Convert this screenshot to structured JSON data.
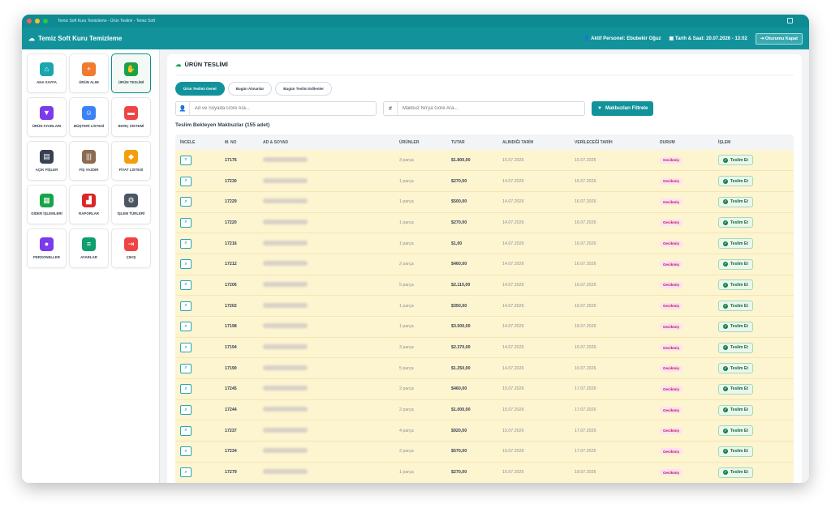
{
  "window": {
    "title": "Temiz Soft Kuru Temizleme - Ürün Teslimi - Temiz Soft"
  },
  "header": {
    "brand": "Temiz Soft Kuru Temizleme",
    "personel_label": "Aktif Personel:",
    "personel_name": "Ebubekir Oğuz",
    "datetime_label": "Tarih & Saat:",
    "datetime_value": "20.07.2026 - 13:02",
    "logout": "Oturumu Kapat"
  },
  "sidebar": {
    "items": [
      {
        "label": "ANA SAYFA",
        "icon": "home-icon",
        "color": "#1aa6ad",
        "glyph": "⌂"
      },
      {
        "label": "ÜRÜN ALIM",
        "icon": "plus-circle-icon",
        "color": "#f07b2e",
        "glyph": "+"
      },
      {
        "label": "ÜRÜN TESLİMİ",
        "icon": "hand-icon",
        "color": "#16a34a",
        "glyph": "✋",
        "active": true
      },
      {
        "label": "ÜRÜN AYARLARI",
        "icon": "tshirt-icon",
        "color": "#7c3aed",
        "glyph": "▼"
      },
      {
        "label": "MÜŞTERİ LİSTESİ",
        "icon": "users-icon",
        "color": "#3b82f6",
        "glyph": "☺"
      },
      {
        "label": "BORÇ SİSTEMİ",
        "icon": "wallet-icon",
        "color": "#ef4444",
        "glyph": "▬"
      },
      {
        "label": "AÇIK FİŞLER",
        "icon": "file-icon",
        "color": "#374151",
        "glyph": "▤"
      },
      {
        "label": "FİŞ YAZDIR",
        "icon": "barcode-icon",
        "color": "#8b6a4f",
        "glyph": "|||"
      },
      {
        "label": "FİYAT LİSTESİ",
        "icon": "tag-icon",
        "color": "#f59e0b",
        "glyph": "◆"
      },
      {
        "label": "GİDER İŞLEMLERİ",
        "icon": "receipt-icon",
        "color": "#16a34a",
        "glyph": "▦"
      },
      {
        "label": "RAPORLAR",
        "icon": "chart-icon",
        "color": "#dc2626",
        "glyph": "▟"
      },
      {
        "label": "İŞLEM TÜRLERİ",
        "icon": "gears-icon",
        "color": "#4b5563",
        "glyph": "⚙"
      },
      {
        "label": "PERSONELLER",
        "icon": "user-icon",
        "color": "#7c3aed",
        "glyph": "●"
      },
      {
        "label": "AYARLAR",
        "icon": "sliders-icon",
        "color": "#0e9f6e",
        "glyph": "≡"
      },
      {
        "label": "ÇIKIŞ",
        "icon": "logout-icon",
        "color": "#ef4444",
        "glyph": "⇥"
      }
    ]
  },
  "main": {
    "title": "ÜRÜN TESLİMİ",
    "tabs": [
      "Ürün Teslimi Genel",
      "Bugün Alınanlar",
      "Bugün Teslim Edilenler"
    ],
    "search_name_placeholder": "Ad ve Soyada Göre Ara...",
    "search_no_placeholder": "Makbuz No'ya Göre Ara...",
    "filter_button": "Makbuzları Filtrele",
    "section_title": "Teslim Bekleyen Makbuzlar (155 adet)",
    "columns": [
      "İNCELE",
      "M. NO",
      "AD & SOYAD",
      "ÜRÜNLER",
      "TUTAR",
      "ALINDIĞI TARİH",
      "VERİLECEĞİ TARİH",
      "DURUM",
      "İŞLEM"
    ],
    "status_label": "Gecikmiş",
    "action_label": "Teslim Et",
    "rows": [
      {
        "no": "17176",
        "items": "3 parça",
        "total": "$1.800,00",
        "received": "15.07.2026",
        "due": "15.07.2026"
      },
      {
        "no": "17230",
        "items": "1 parça",
        "total": "$270,00",
        "received": "14.07.2026",
        "due": "16.07.2026"
      },
      {
        "no": "17229",
        "items": "1 parça",
        "total": "$500,00",
        "received": "14.07.2026",
        "due": "16.07.2026"
      },
      {
        "no": "17220",
        "items": "1 parça",
        "total": "$270,00",
        "received": "14.07.2026",
        "due": "16.07.2026"
      },
      {
        "no": "17216",
        "items": "1 parça",
        "total": "$1,00",
        "received": "14.07.2026",
        "due": "16.07.2026"
      },
      {
        "no": "17212",
        "items": "2 parça",
        "total": "$460,00",
        "received": "14.07.2026",
        "due": "16.07.2026"
      },
      {
        "no": "17206",
        "items": "5 parça",
        "total": "$2.110,00",
        "received": "14.07.2026",
        "due": "16.07.2026"
      },
      {
        "no": "17202",
        "items": "1 parça",
        "total": "$350,00",
        "received": "14.07.2026",
        "due": "16.07.2026"
      },
      {
        "no": "17198",
        "items": "1 parça",
        "total": "$3.500,00",
        "received": "14.07.2026",
        "due": "18.07.2026"
      },
      {
        "no": "17194",
        "items": "3 parça",
        "total": "$2.370,00",
        "received": "14.07.2026",
        "due": "16.07.2026"
      },
      {
        "no": "17190",
        "items": "5 parça",
        "total": "$1.250,00",
        "received": "14.07.2026",
        "due": "16.07.2026"
      },
      {
        "no": "17245",
        "items": "2 parça",
        "total": "$460,00",
        "received": "15.07.2026",
        "due": "17.07.2026"
      },
      {
        "no": "17244",
        "items": "2 parça",
        "total": "$1.000,00",
        "received": "15.07.2026",
        "due": "17.07.2026"
      },
      {
        "no": "17237",
        "items": "4 parça",
        "total": "$920,00",
        "received": "15.07.2026",
        "due": "17.07.2026"
      },
      {
        "no": "17234",
        "items": "2 parça",
        "total": "$570,00",
        "received": "15.07.2026",
        "due": "17.07.2026"
      },
      {
        "no": "17279",
        "items": "1 parça",
        "total": "$270,00",
        "received": "16.07.2026",
        "due": "18.07.2026"
      }
    ]
  }
}
